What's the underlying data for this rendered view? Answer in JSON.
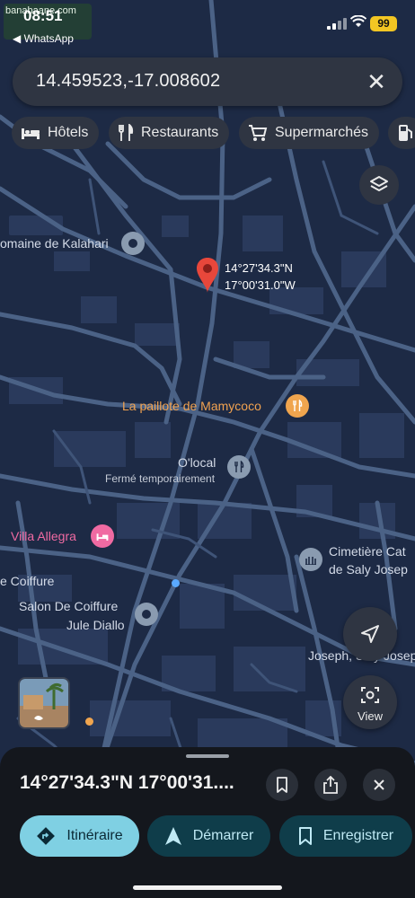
{
  "status_bar": {
    "time": "08:51",
    "back_app": "◀ WhatsApp",
    "watermark": "banabaane.com",
    "battery": "99"
  },
  "search": {
    "value": "14.459523,-17.008602",
    "close_icon": "close-icon"
  },
  "chips": [
    {
      "label": "Hôtels",
      "icon": "bed-icon"
    },
    {
      "label": "Restaurants",
      "icon": "fork-knife-icon"
    },
    {
      "label": "Supermarchés",
      "icon": "cart-icon"
    },
    {
      "label": "",
      "icon": "fuel-icon"
    }
  ],
  "map": {
    "labels": {
      "kalahari": "omaine de Kalahari",
      "coord_lat": "14°27'34.3\"N",
      "coord_lng": "17°00'31.0\"W",
      "mamycoco": "La paillote de Mamycoco",
      "olocal": "O'local",
      "olocal_status": "Fermé temporairement",
      "villa": "Villa Allegra",
      "cimetiere_1": "Cimetière Cat",
      "cimetiere_2": "de Saly Josep",
      "coiffure_1": "e Coiffure",
      "salon_1": "Salon De Coiffure",
      "salon_2": "Jule Diallo",
      "joseph": "Joseph, Saly Josep"
    },
    "colors": {
      "background": "#1d2a45",
      "roads": "#4b6286",
      "buildings": "#2a3a5c",
      "pin": "#e8473b"
    }
  },
  "buttons": {
    "view_label": "View"
  },
  "sheet": {
    "title": "14°27'34.3\"N 17°00'31....",
    "actions": [
      {
        "label": "Itinéraire",
        "icon": "directions-icon"
      },
      {
        "label": "Démarrer",
        "icon": "navigation-arrow-icon"
      },
      {
        "label": "Enregistrer",
        "icon": "bookmark-icon"
      }
    ]
  }
}
